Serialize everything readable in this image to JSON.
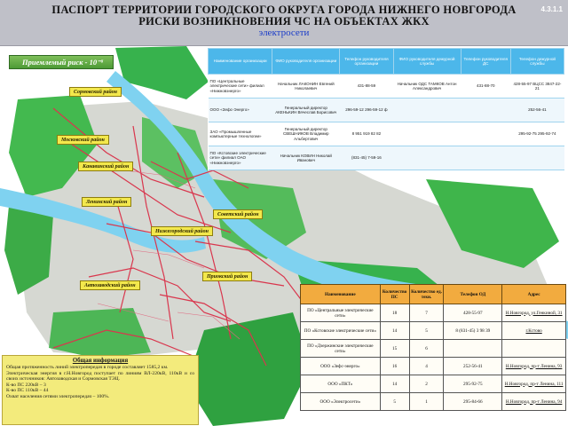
{
  "header": {
    "title_line1": "ПАСПОРТ ТЕРРИТОРИИ ГОРОДСКОГО ОКРУГА ГОРОДА НИЖНЕГО НОВГОРОДА",
    "title_line2": "РИСКИ ВОЗНИКНОВЕНИЯ ЧС НА ОБЪЕКТАХ ЖКХ",
    "subtitle": "электросети",
    "code": "4.3.1.1"
  },
  "map": {
    "risk_label": "Приемлемый риск - 10⁻⁶",
    "districts": [
      "Сормовский район",
      "Московский район",
      "Канавинский район",
      "Ленинский район",
      "Нижегородский район",
      "Советский район",
      "Автозаводский район",
      "Приокский район"
    ],
    "colors": {
      "forest": "#37b24d",
      "water": "#7fd2f0",
      "grid": "#d9364d",
      "district_label": "#f3e84c"
    }
  },
  "top_table": {
    "headers": [
      "Наименование организации",
      "ФИО руководителя организации",
      "Телефон руководителя организации",
      "ФИО руководителя дежурной службы",
      "Телефон руководителя ДС",
      "Телефон дежурной службы"
    ],
    "rows": [
      {
        "org": "ПО «Центральные электрические сети» филиал «Нижновэнерго»",
        "head": "Начальник ЛАКОНИН Евгений Николаевич",
        "head_phone": "431-88-59",
        "ds_head": "Начальник ОДС ТАМКОВ Антон Александрович",
        "ds_phone": "431-88-70",
        "duty_phone": "428-55-97 ВЦСС 3847-22-21"
      },
      {
        "org": "ООО «Зефс-Энерго»",
        "head": "Генеральный директор АКЕНЬКИН Вячеслав Борисович",
        "head_phone": "296-59-12 296-59-12 ф",
        "ds_head": "",
        "ds_phone": "",
        "duty_phone": "252-56-41"
      },
      {
        "org": "ЗАО «Промышленные компьютерные технологии»",
        "head": "Генеральный директор СВЕШНИКОВ Владимир Альбертович",
        "head_phone": "8 951 919 82 82",
        "ds_head": "",
        "ds_phone": "",
        "duty_phone": "295-92-75 295-92-74"
      },
      {
        "org": "ПО «Кстовские электрические сети» филиал ОАО «Нижновэнерго»",
        "head": "Начальник КОВИН Николай Иванович",
        "head_phone": "(831-45) 7-59-16",
        "ds_head": "",
        "ds_phone": "",
        "duty_phone": ""
      }
    ]
  },
  "bottom_table": {
    "headers": [
      "Наименование",
      "Количество ПС",
      "Количество ед. техн.",
      "Телефон ОД",
      "Адрес"
    ],
    "rows": [
      {
        "name": "ПО «Центральные электрические сети»",
        "ps": "18",
        "tech": "7",
        "phone": "428-55-97",
        "addr": "Н.Новгород, ул.Генкиной, 31"
      },
      {
        "name": "ПО «Кстовские электрические сети»",
        "ps": "14",
        "tech": "5",
        "phone": "8 (831-45) 3 98 39",
        "addr": "г.Кстово"
      },
      {
        "name": "ПО «Дзержинские электрические сети»",
        "ps": "15",
        "tech": "6",
        "phone": "",
        "addr": ""
      },
      {
        "name": "ООО «Зефс-энерго»",
        "ps": "16",
        "tech": "4",
        "phone": "252-56-41",
        "addr": "Н.Новгород, пр-т Ленина, 93"
      },
      {
        "name": "ООО «ПКТ»",
        "ps": "14",
        "tech": "2",
        "phone": "295-92-75",
        "addr": "Н.Новгород, пр-т Ленина, 111"
      },
      {
        "name": "ООО «Электросети»",
        "ps": "5",
        "tech": "1",
        "phone": "295-84-66",
        "addr": "Н.Новгород, пр-т Ленина, 94"
      }
    ]
  },
  "info": {
    "title": "Общая информация",
    "lines": [
      "Общая протяженность линий электропередач в городе составляет 1585,2 км.",
      "Электрическая энергия в г.Н.Новгород поступает по линиям ВЛ-220кВ, 110кВ и со своих источников: Автозаводская и Сормовская ТЭЦ.",
      "К-во ПС 220кВ – 3",
      "К-во ПС 110кВ – 44",
      "Охват населения сетями электропередач – 100%."
    ]
  }
}
